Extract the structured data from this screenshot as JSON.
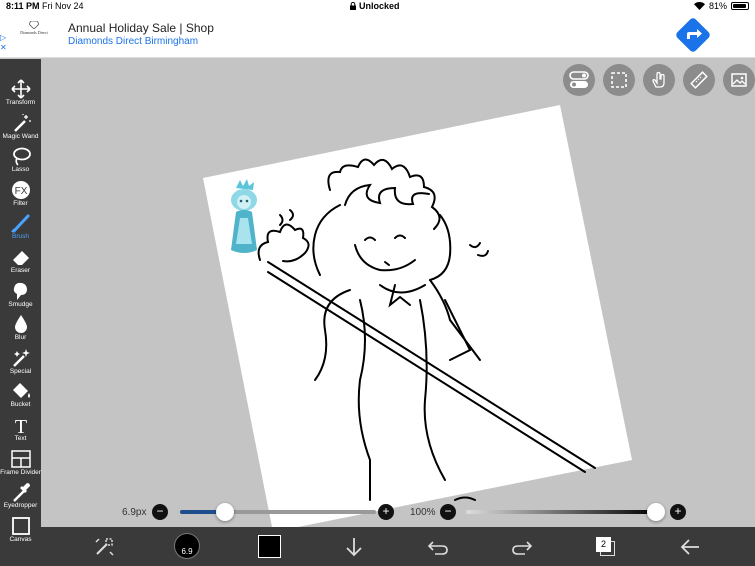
{
  "status_bar": {
    "time": "8:11 PM",
    "date": "Fri Nov 24",
    "center": "Unlocked",
    "battery": "81%",
    "battery_level": 0.81
  },
  "ad": {
    "logo_text": "Diamonds Direct",
    "title": "Annual Holiday Sale | Shop",
    "subtitle": "Diamonds Direct Birmingham",
    "adchoices_icon": "play-triangle-icon",
    "close_icon": "x-icon",
    "directions_icon": "directions-arrow-icon"
  },
  "tools": [
    {
      "label": "Transform",
      "icon": "move-arrows-icon"
    },
    {
      "label": "Magic Wand",
      "icon": "magic-wand-icon"
    },
    {
      "label": "Lasso",
      "icon": "lasso-icon"
    },
    {
      "label": "Filter",
      "icon": "fx-icon"
    },
    {
      "label": "Brush",
      "icon": "brush-icon",
      "active": true
    },
    {
      "label": "Eraser",
      "icon": "eraser-icon"
    },
    {
      "label": "Smudge",
      "icon": "smudge-icon"
    },
    {
      "label": "Blur",
      "icon": "drop-icon"
    },
    {
      "label": "Special",
      "icon": "sparkle-icon"
    },
    {
      "label": "Bucket",
      "icon": "bucket-icon"
    },
    {
      "label": "Text",
      "icon": "text-icon"
    },
    {
      "label": "Frame Divider",
      "icon": "frame-divider-icon"
    },
    {
      "label": "Eyedropper",
      "icon": "eyedropper-icon"
    },
    {
      "label": "Canvas",
      "icon": "canvas-icon"
    }
  ],
  "top_buttons": [
    "toggle-icon",
    "selection-icon",
    "hand-icon",
    "ruler-icon",
    "image-icon"
  ],
  "brush_size": {
    "value": "6.9px",
    "fraction": 0.23
  },
  "opacity": {
    "value": "100%",
    "fraction": 1.0
  },
  "bottom_bar": {
    "brush_badge": "6.9",
    "color": "#000000",
    "layers_count": "2",
    "icons": [
      "adjust-icon",
      "brush-size-icon",
      "color-swatch-icon",
      "down-arrow-icon",
      "undo-icon",
      "redo-icon",
      "layers-icon",
      "back-arrow-icon"
    ]
  },
  "colors": {
    "toolbar_bg": "#3a3a3a",
    "active": "#4aa3ff",
    "slider_fill": "#1e4e8c",
    "canvas_bg": "#c4c4c4"
  }
}
